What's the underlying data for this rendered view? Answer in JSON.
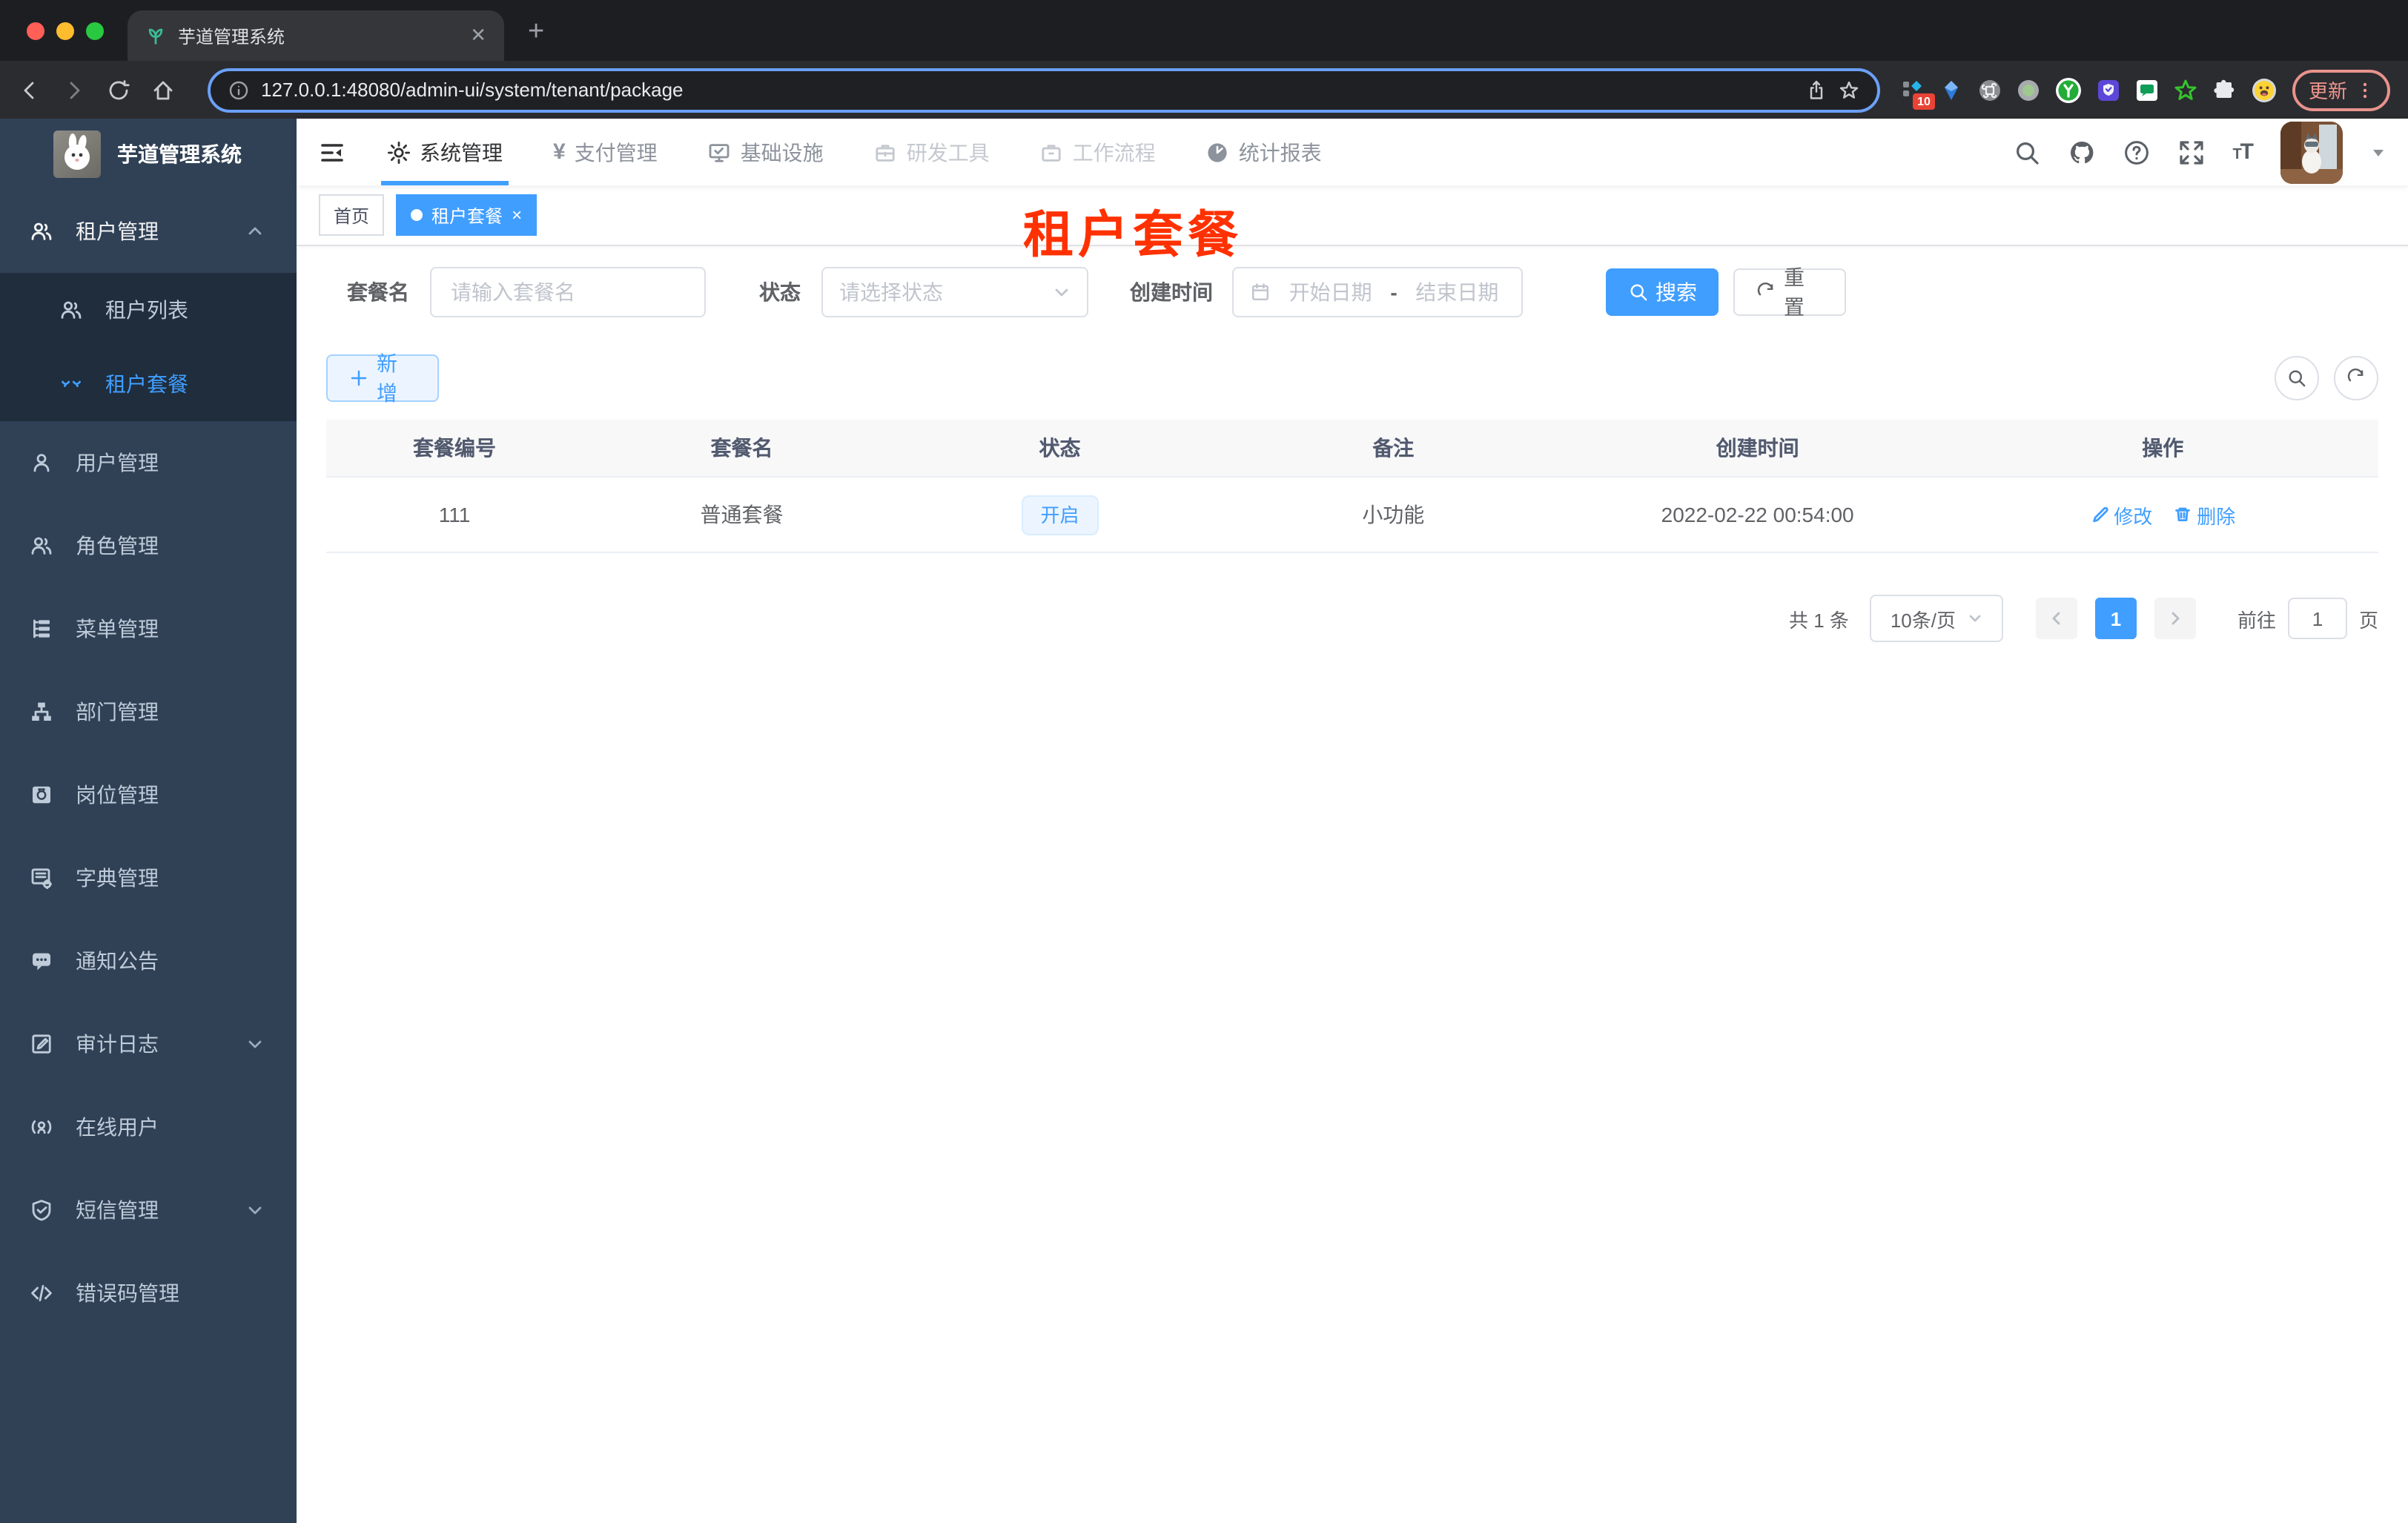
{
  "colors": {
    "accent": "#409eff",
    "sidebar_bg": "#304156",
    "submenu_bg": "#1f2d3d",
    "overlay_red": "#ff3100",
    "status_tag_bg": "#ecf5ff",
    "tag_active_bg": "#409eff"
  },
  "browser": {
    "tab_title": "芋道管理系统",
    "url": "127.0.0.1:48080/admin-ui/system/tenant/package",
    "update_label": "更新",
    "extensions_badge": "10"
  },
  "app_header": {
    "nav": [
      {
        "label": "系统管理"
      },
      {
        "label": "支付管理"
      },
      {
        "label": "基础设施"
      },
      {
        "label": "研发工具"
      },
      {
        "label": "工作流程"
      },
      {
        "label": "统计报表"
      }
    ]
  },
  "sidebar": {
    "title": "芋道管理系统",
    "items": [
      {
        "label": "租户管理"
      },
      {
        "label": "租户列表"
      },
      {
        "label": "租户套餐"
      },
      {
        "label": "用户管理"
      },
      {
        "label": "角色管理"
      },
      {
        "label": "菜单管理"
      },
      {
        "label": "部门管理"
      },
      {
        "label": "岗位管理"
      },
      {
        "label": "字典管理"
      },
      {
        "label": "通知公告"
      },
      {
        "label": "审计日志"
      },
      {
        "label": "在线用户"
      },
      {
        "label": "短信管理"
      },
      {
        "label": "错误码管理"
      }
    ]
  },
  "tags": {
    "home": "首页",
    "active": "租户套餐"
  },
  "overlay_title": "租户套餐",
  "filters": {
    "name_label": "套餐名",
    "name_placeholder": "请输入套餐名",
    "status_label": "状态",
    "status_placeholder": "请选择状态",
    "time_label": "创建时间",
    "start_placeholder": "开始日期",
    "separator": "-",
    "end_placeholder": "结束日期",
    "search": "搜索",
    "reset": "重置"
  },
  "toolbar": {
    "add": "新增"
  },
  "table": {
    "columns": [
      "套餐编号",
      "套餐名",
      "状态",
      "备注",
      "创建时间",
      "操作"
    ],
    "row": {
      "id": "111",
      "name": "普通套餐",
      "status": "开启",
      "remark": "小功能",
      "created": "2022-02-22 00:54:00"
    },
    "actions": {
      "edit": "修改",
      "delete": "删除"
    }
  },
  "pagination": {
    "total": "共 1 条",
    "page_size": "10条/页",
    "current": "1",
    "goto": "前往",
    "goto_value": "1",
    "page_unit": "页"
  }
}
